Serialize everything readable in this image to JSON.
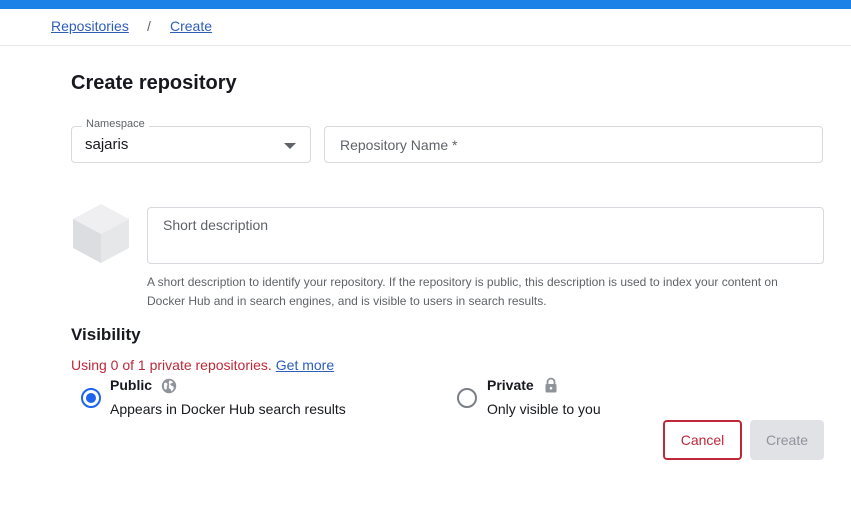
{
  "breadcrumb": {
    "items": [
      {
        "label": "Repositories"
      },
      {
        "label": "Create"
      }
    ],
    "separator": "/"
  },
  "page": {
    "title": "Create repository"
  },
  "form": {
    "namespace": {
      "label": "Namespace",
      "value": "sajaris"
    },
    "repository_name": {
      "placeholder": "Repository Name *",
      "value": ""
    },
    "short_description": {
      "placeholder": "Short description",
      "value": "",
      "helper": "A short description to identify your repository. If the repository is public, this description is used to index your content on Docker Hub and in search engines, and is visible to users in search results."
    }
  },
  "visibility": {
    "heading": "Visibility",
    "usage_text": "Using 0 of 1 private repositories.",
    "get_more_label": "Get more",
    "options": [
      {
        "title": "Public",
        "description": "Appears in Docker Hub search results",
        "icon": "globe-icon",
        "selected": true
      },
      {
        "title": "Private",
        "description": "Only visible to you",
        "icon": "lock-icon",
        "selected": false
      }
    ]
  },
  "actions": {
    "cancel_label": "Cancel",
    "create_label": "Create"
  },
  "colors": {
    "accent": "#1d63ed",
    "top_bar": "#1d82e8",
    "link": "#2f5dba",
    "danger": "#c0283a",
    "disabled_bg": "#e1e2e6"
  }
}
